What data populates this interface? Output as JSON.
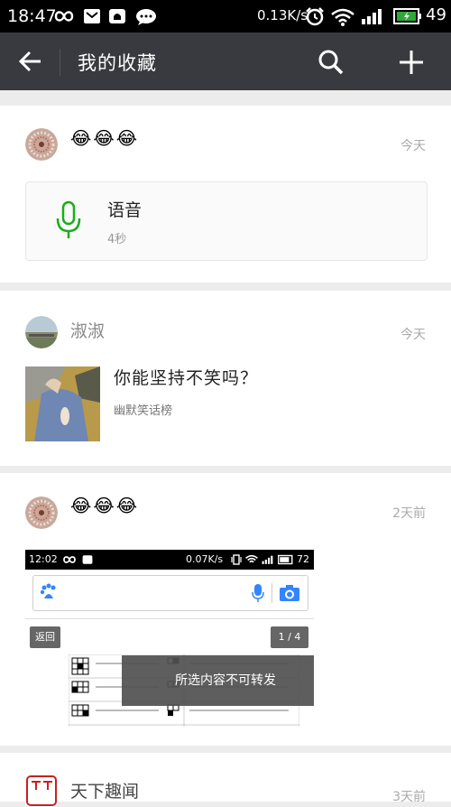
{
  "status": {
    "time": "18:47",
    "speed": "0.13K/s",
    "battery": "49",
    "icons": [
      "infinity-icon",
      "mail-icon",
      "notification-icon",
      "chat-bubble-icon",
      "alarm-icon",
      "wifi-icon",
      "signal-icon",
      "battery-icon"
    ]
  },
  "header": {
    "title": "我的收藏",
    "back_icon": "back-arrow-icon",
    "search_icon": "search-icon",
    "add_icon": "add-icon"
  },
  "items": [
    {
      "type": "voice",
      "name": "😂😂😂",
      "date": "今天",
      "voice_title": "语音",
      "voice_duration": "4秒",
      "accent": "#1aad19"
    },
    {
      "type": "article",
      "name": "淑淑",
      "date": "今天",
      "article_title": "你能坚持不笑吗？",
      "article_source": "幽默笑话榜"
    },
    {
      "type": "image",
      "name": "😂😂😂",
      "date": "2天前",
      "screenshot": {
        "time": "12:02",
        "speed": "0.07K/s",
        "battery": "72",
        "back_label": "返回",
        "page_indicator": "1 / 4",
        "toast": "所选内容不可转发"
      }
    },
    {
      "type": "partial",
      "name": "天下趣闻",
      "date": "3天前"
    }
  ]
}
